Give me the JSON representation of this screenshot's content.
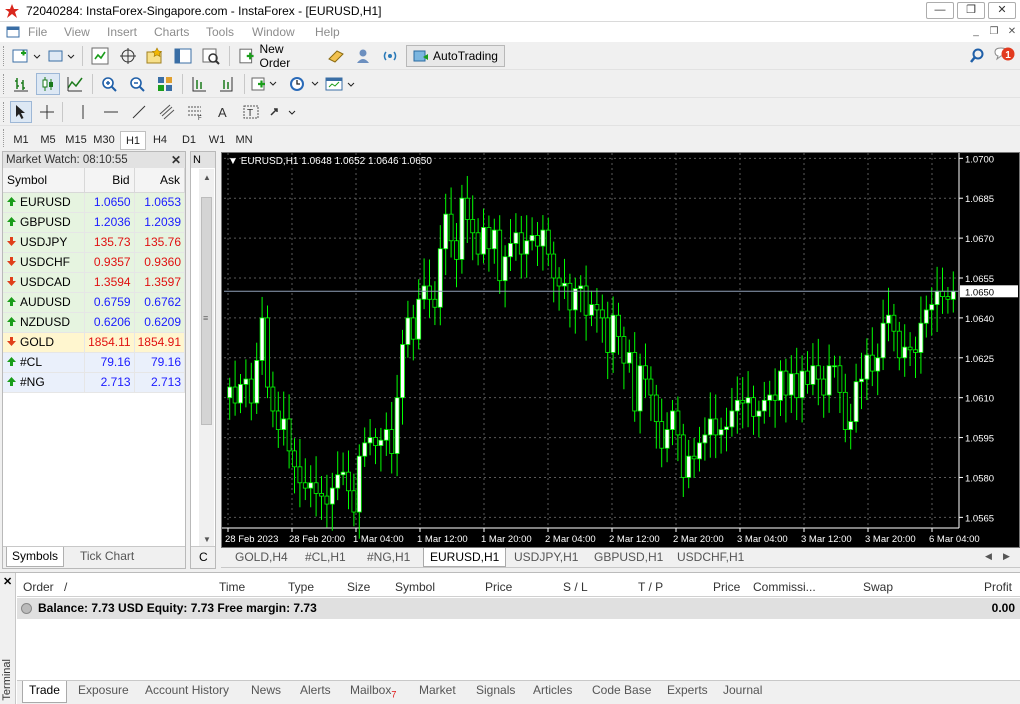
{
  "window": {
    "title": "72040284: InstaForex-Singapore.com - InstaForex - [EURUSD,H1]",
    "minimize": "—",
    "restore": "❐",
    "close": "✕"
  },
  "menu": [
    "File",
    "View",
    "Insert",
    "Charts",
    "Tools",
    "Window",
    "Help"
  ],
  "notification_count": "1",
  "toolbar": {
    "new_order_label": "New Order",
    "autotrading_label": "AutoTrading"
  },
  "timeframes": [
    "M1",
    "M5",
    "M15",
    "M30",
    "H1",
    "H4",
    "D1",
    "W1",
    "MN"
  ],
  "active_timeframe": "H1",
  "market_watch": {
    "title": "Market Watch: 08:10:55",
    "close": "✕",
    "columns": [
      "Symbol",
      "Bid",
      "Ask"
    ],
    "rows": [
      {
        "symbol": "EURUSD",
        "bid": "1.0650",
        "ask": "1.0653",
        "dir": "up",
        "color": "#1a1aff"
      },
      {
        "symbol": "GBPUSD",
        "bid": "1.2036",
        "ask": "1.2039",
        "dir": "up",
        "color": "#1a1aff"
      },
      {
        "symbol": "USDJPY",
        "bid": "135.73",
        "ask": "135.76",
        "dir": "down",
        "color": "#e01010"
      },
      {
        "symbol": "USDCHF",
        "bid": "0.9357",
        "ask": "0.9360",
        "dir": "down",
        "color": "#e01010"
      },
      {
        "symbol": "USDCAD",
        "bid": "1.3594",
        "ask": "1.3597",
        "dir": "down",
        "color": "#e01010"
      },
      {
        "symbol": "AUDUSD",
        "bid": "0.6759",
        "ask": "0.6762",
        "dir": "up",
        "color": "#1a1aff"
      },
      {
        "symbol": "NZDUSD",
        "bid": "0.6206",
        "ask": "0.6209",
        "dir": "up",
        "color": "#1a1aff"
      },
      {
        "symbol": "GOLD",
        "bid": "1854.11",
        "ask": "1854.91",
        "dir": "down",
        "color": "#e01010"
      },
      {
        "symbol": "#CL",
        "bid": "79.16",
        "ask": "79.16",
        "dir": "up",
        "color": "#1a1aff"
      },
      {
        "symbol": "#NG",
        "bid": "2.713",
        "ask": "2.713",
        "dir": "up",
        "color": "#1a1aff"
      }
    ],
    "tabs": [
      "Symbols",
      "Tick Chart"
    ]
  },
  "navigator": {
    "title": "N",
    "bottom_tab": "C"
  },
  "chart": {
    "header": "EURUSD,H1  1.0648 1.0652 1.0646 1.0650",
    "symbol": "EURUSD",
    "timeframe": "H1",
    "ohlc": {
      "open": 1.0648,
      "high": 1.0652,
      "low": 1.0646,
      "close": 1.065
    },
    "price_ticks": [
      "1.0700",
      "1.0685",
      "1.0670",
      "1.0655",
      "1.0640",
      "1.0625",
      "1.0610",
      "1.0595",
      "1.0580",
      "1.0565"
    ],
    "current_price": "1.0650",
    "time_ticks": [
      "28 Feb 2023",
      "28 Feb 20:00",
      "1 Mar 04:00",
      "1 Mar 12:00",
      "1 Mar 20:00",
      "2 Mar 04:00",
      "2 Mar 12:00",
      "2 Mar 20:00",
      "3 Mar 04:00",
      "3 Mar 12:00",
      "3 Mar 20:00",
      "6 Mar 04:00"
    ],
    "y_range": [
      1.0561,
      1.0702
    ],
    "bull_color": "#ffffff",
    "bear_color": "#000000",
    "wick_color": "#00ff00",
    "grid": true,
    "closes": [
      1.0614,
      1.0608,
      1.0615,
      1.0617,
      1.0608,
      1.0624,
      1.064,
      1.0614,
      1.0605,
      1.0598,
      1.0602,
      1.059,
      1.0584,
      1.0578,
      1.0576,
      1.0578,
      1.0574,
      1.0573,
      1.057,
      1.0576,
      1.0581,
      1.0582,
      1.0575,
      1.0567,
      1.0588,
      1.0593,
      1.0595,
      1.0592,
      1.0594,
      1.0598,
      1.0589,
      1.061,
      1.063,
      1.064,
      1.0632,
      1.0647,
      1.0652,
      1.0647,
      1.0644,
      1.0666,
      1.0679,
      1.0669,
      1.0662,
      1.0685,
      1.0677,
      1.0672,
      1.0664,
      1.0674,
      1.0666,
      1.0673,
      1.0654,
      1.0663,
      1.0668,
      1.0672,
      1.0664,
      1.0669,
      1.0671,
      1.0667,
      1.0673,
      1.0664,
      1.0655,
      1.0652,
      1.0653,
      1.0643,
      1.0651,
      1.0652,
      1.0641,
      1.0645,
      1.0643,
      1.064,
      1.0627,
      1.0641,
      1.0633,
      1.0623,
      1.0627,
      1.0605,
      1.0622,
      1.0617,
      1.0611,
      1.0601,
      1.0591,
      1.0598,
      1.0605,
      1.0596,
      1.058,
      1.0588,
      1.0587,
      1.0593,
      1.0596,
      1.0602,
      1.0596,
      1.0598,
      1.0599,
      1.0605,
      1.0609,
      1.0608,
      1.061,
      1.0603,
      1.0605,
      1.0609,
      1.0611,
      1.0609,
      1.062,
      1.0611,
      1.0619,
      1.061,
      1.062,
      1.0615,
      1.0622,
      1.0617,
      1.0611,
      1.0622,
      1.0622,
      1.0612,
      1.0598,
      1.0601,
      1.0616,
      1.0617,
      1.0626,
      1.062,
      1.0625,
      1.0638,
      1.0641,
      1.0635,
      1.0625,
      1.0629,
      1.0628,
      1.0627,
      1.0638,
      1.0643,
      1.0645,
      1.065,
      1.0648,
      1.0647,
      1.065
    ]
  },
  "chart_tabs": [
    "GOLD,H4",
    "#CL,H1",
    "#NG,H1",
    "EURUSD,H1",
    "USDJPY,H1",
    "GBPUSD,H1",
    "USDCHF,H1"
  ],
  "active_chart_tab": "EURUSD,H1",
  "terminal": {
    "side_label": "Terminal",
    "columns": [
      "Order",
      "/",
      "Time",
      "Type",
      "Size",
      "Symbol",
      "Price",
      "S / L",
      "T / P",
      "Price",
      "Commissi...",
      "Swap",
      "Profit"
    ],
    "balance": "Balance: 7.73 USD  Equity: 7.73  Free margin: 7.73",
    "profit": "0.00",
    "tabs": [
      "Trade",
      "Exposure",
      "Account History",
      "News",
      "Alerts",
      "Mailbox",
      "Market",
      "Signals",
      "Articles",
      "Code Base",
      "Experts",
      "Journal"
    ],
    "mailbox_badge": "7",
    "active_tab": "Trade"
  }
}
